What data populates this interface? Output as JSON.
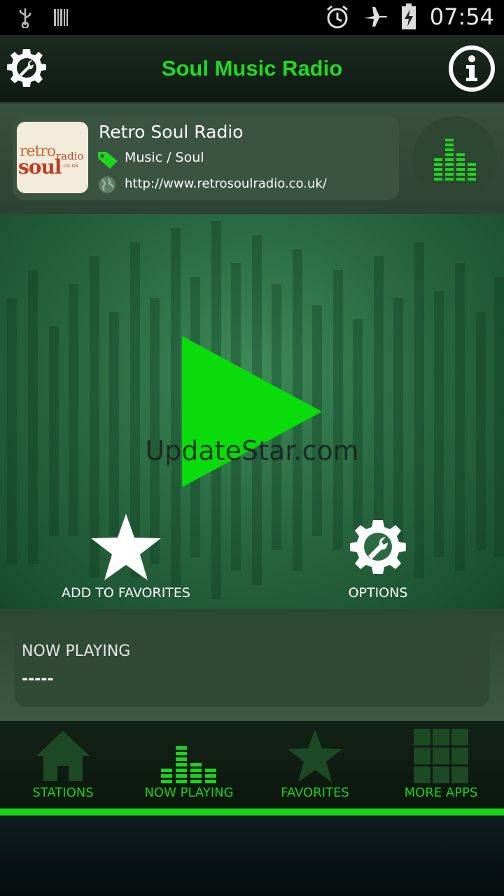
{
  "status_bar": {
    "time": "07:54",
    "icons": [
      "usb-icon",
      "barcode-icon",
      "alarm-icon",
      "airplane-mode-icon",
      "battery-charging-icon"
    ]
  },
  "app_bar": {
    "title": "Soul Music Radio",
    "left_icon": "settings-wrench-icon",
    "right_icon": "info-icon"
  },
  "station": {
    "name": "Retro Soul Radio",
    "genre": "Music / Soul",
    "url": "http://www.retrosoulradio.co.uk/",
    "logo": {
      "line1": "retro",
      "line2": "soul",
      "line3": "radio",
      "line4": ".co.uk"
    }
  },
  "player": {
    "watermark": "UpdateStar.com",
    "add_favorites_label": "ADD TO FAVORITES",
    "options_label": "OPTIONS"
  },
  "now_playing": {
    "title": "NOW PLAYING",
    "track": "-----"
  },
  "bottom_nav": {
    "items": [
      {
        "label": "STATIONS",
        "icon": "home-icon"
      },
      {
        "label": "NOW PLAYING",
        "icon": "equalizer-icon",
        "active": true
      },
      {
        "label": "FAVORITES",
        "icon": "star-icon"
      },
      {
        "label": "MORE APPS",
        "icon": "grid-icon"
      }
    ]
  },
  "colors": {
    "accent": "#1fdb1f",
    "background": "#000000",
    "player_bg": "#2a6a42",
    "card_bg": "#3c5542"
  }
}
